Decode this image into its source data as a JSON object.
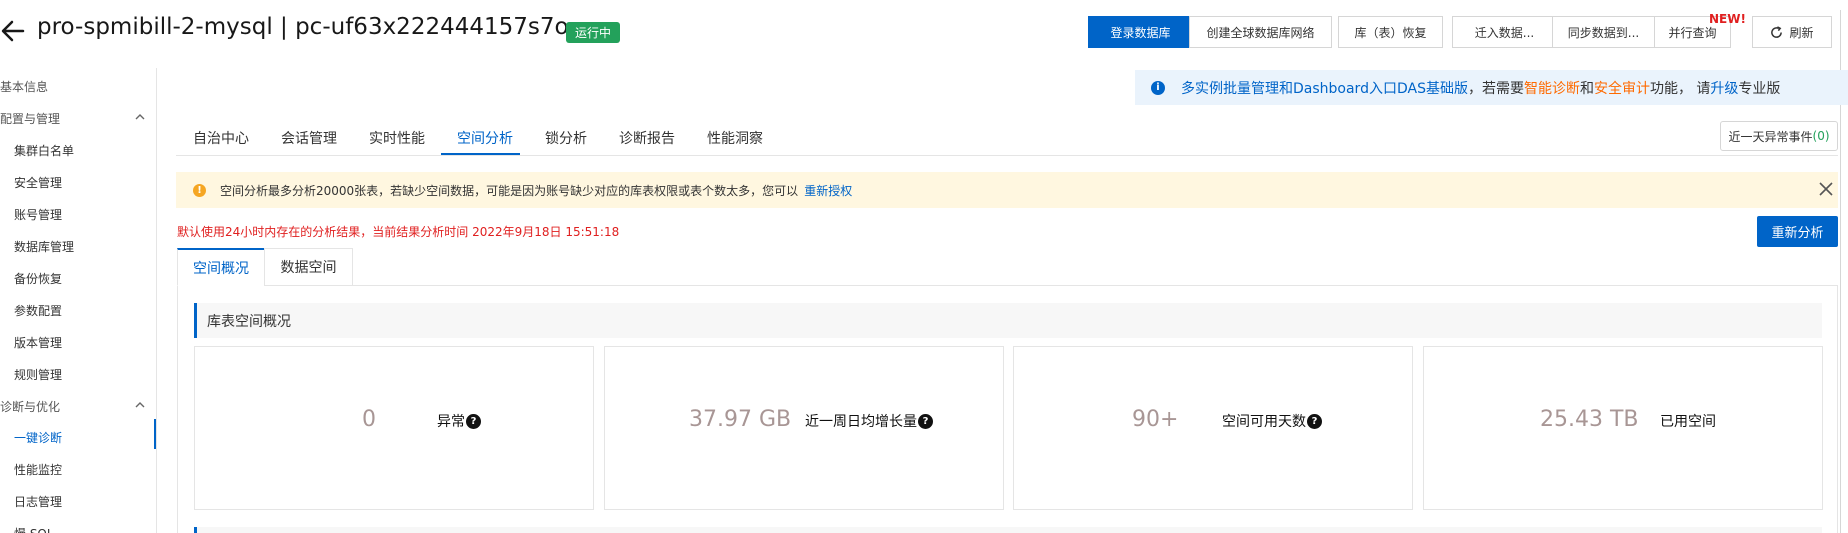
{
  "header": {
    "title": "pro-spmibill-2-mysql | pc-uf63x222444157s7o",
    "status": "运行中",
    "buttons": {
      "login_db": "登录数据库",
      "create_global_network": "创建全球数据库网络",
      "table_restore": "库（表）恢复",
      "migrate_in": "迁入数据...",
      "sync_to": "同步数据到...",
      "parallel_query": "并行查询",
      "refresh": "刷新"
    },
    "new_tag": "NEW!"
  },
  "sidebar": {
    "group_basic": "基本信息",
    "group_config": "配置与管理",
    "config_items": [
      "集群白名单",
      "安全管理",
      "账号管理",
      "数据库管理",
      "备份恢复",
      "参数配置",
      "版本管理",
      "规则管理"
    ],
    "group_diag": "诊断与优化",
    "diag_items": [
      "一键诊断",
      "性能监控",
      "日志管理",
      "慢 SQL"
    ]
  },
  "promo": {
    "text1": "多实例批量管理和Dashboard入口DAS基础版",
    "text2": "，若需要 ",
    "smart_diag": "智能诊断",
    "and": " 和 ",
    "security_audit": "安全审计",
    "text3": " 功能，  请 ",
    "upgrade": "升级",
    "text4": " 专业版"
  },
  "tabs": [
    "自治中心",
    "会话管理",
    "实时性能",
    "空间分析",
    "锁分析",
    "诊断报告",
    "性能洞察"
  ],
  "active_tab": "空间分析",
  "event_button": {
    "label": "近一天异常事件",
    "count_open": "(",
    "count": "0",
    "count_close": ")"
  },
  "alert": {
    "icon": "!",
    "text": "空间分析最多分析20000张表，若缺少空间数据，可能是因为账号缺少对应的库表权限或表个数太多，您可以",
    "link": "重新授权"
  },
  "note": "默认使用24小时内存在的分析结果，当前结果分析时间 2022年9月18日 15:51:18",
  "reanalyze": "重新分析",
  "subtabs": [
    "空间概况",
    "数据空间"
  ],
  "section_title": "库表空间概况",
  "cards": [
    {
      "value": "0",
      "label": "异常",
      "help": true
    },
    {
      "value": "37.97 GB",
      "label": "近一周日均增长量",
      "help": true
    },
    {
      "value": "90+",
      "label": "空间可用天数",
      "help": true
    },
    {
      "value": "25.43 TB",
      "label": "已用空间",
      "help": false
    }
  ],
  "icons": [
    "back-arrow-icon",
    "refresh-icon",
    "chevron-up-icon",
    "info-icon",
    "warning-icon",
    "close-icon",
    "help-icon"
  ],
  "colors": {
    "primary": "#0064c8",
    "success": "#23a15b",
    "danger": "#e02020",
    "orange": "#ff6a00",
    "alert_bg": "#fff7e0"
  }
}
